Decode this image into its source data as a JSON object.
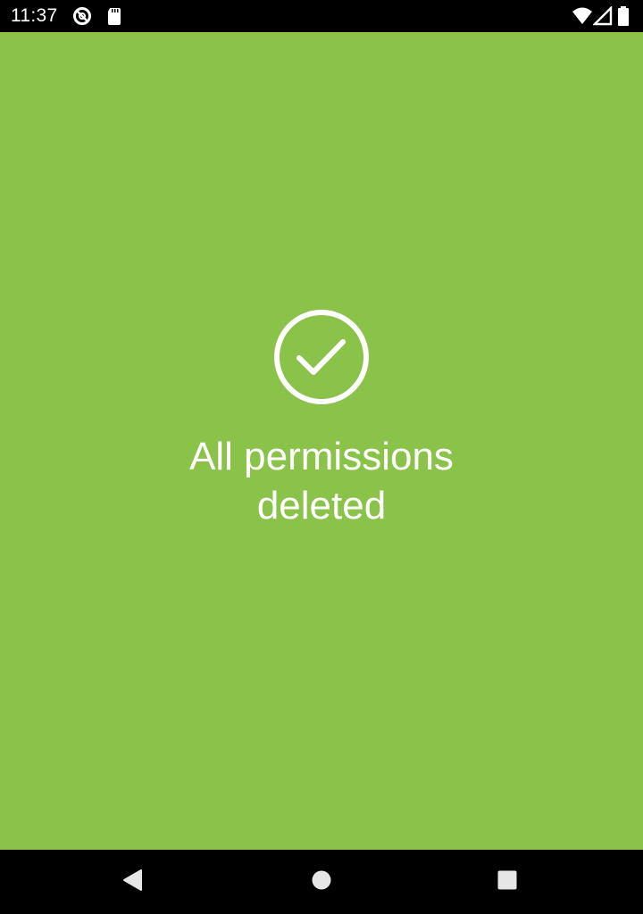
{
  "status_bar": {
    "time": "11:37",
    "icons": [
      "data-saver-icon",
      "sd-card-icon",
      "wifi-icon",
      "cell-signal-icon",
      "battery-icon"
    ]
  },
  "main": {
    "background_color": "#8bc34a",
    "icon": "check-circle-icon",
    "message_line1": "All permissions",
    "message_line2": "deleted"
  },
  "nav_bar": {
    "buttons": [
      "back-icon",
      "home-icon",
      "recents-icon"
    ]
  }
}
